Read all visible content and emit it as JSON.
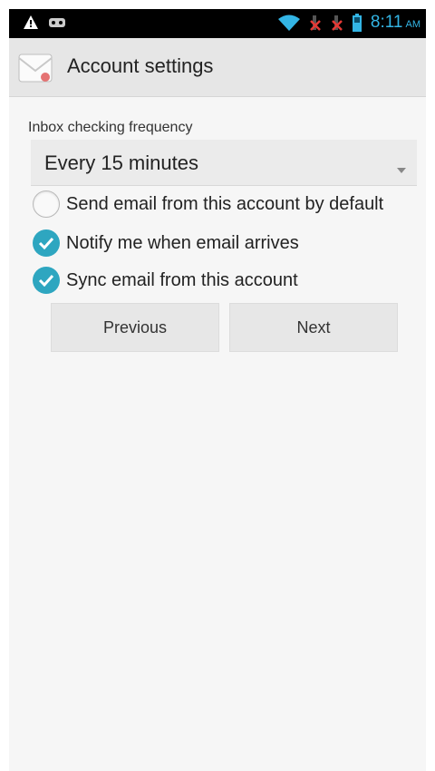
{
  "status_bar": {
    "time": "8:11",
    "ampm": "AM",
    "icons_left": [
      "warning-icon",
      "voicemail-icon"
    ],
    "icons_right": [
      "wifi-icon",
      "signal-off-icon",
      "signal-off-icon",
      "battery-icon"
    ]
  },
  "action_bar": {
    "title": "Account settings",
    "app_icon": "email-icon"
  },
  "form": {
    "frequency_label": "Inbox checking frequency",
    "frequency_value": "Every 15 minutes",
    "options": [
      {
        "label": "Send email from this account by default",
        "checked": false
      },
      {
        "label": "Notify me when email arrives",
        "checked": true
      },
      {
        "label": "Sync email from this account",
        "checked": true
      }
    ]
  },
  "buttons": {
    "previous": "Previous",
    "next": "Next"
  },
  "colors": {
    "accent": "#33b5e5",
    "checkbox": "#2ea6c0",
    "background": "#f6f6f6",
    "action_bar": "#e6e6e6"
  }
}
